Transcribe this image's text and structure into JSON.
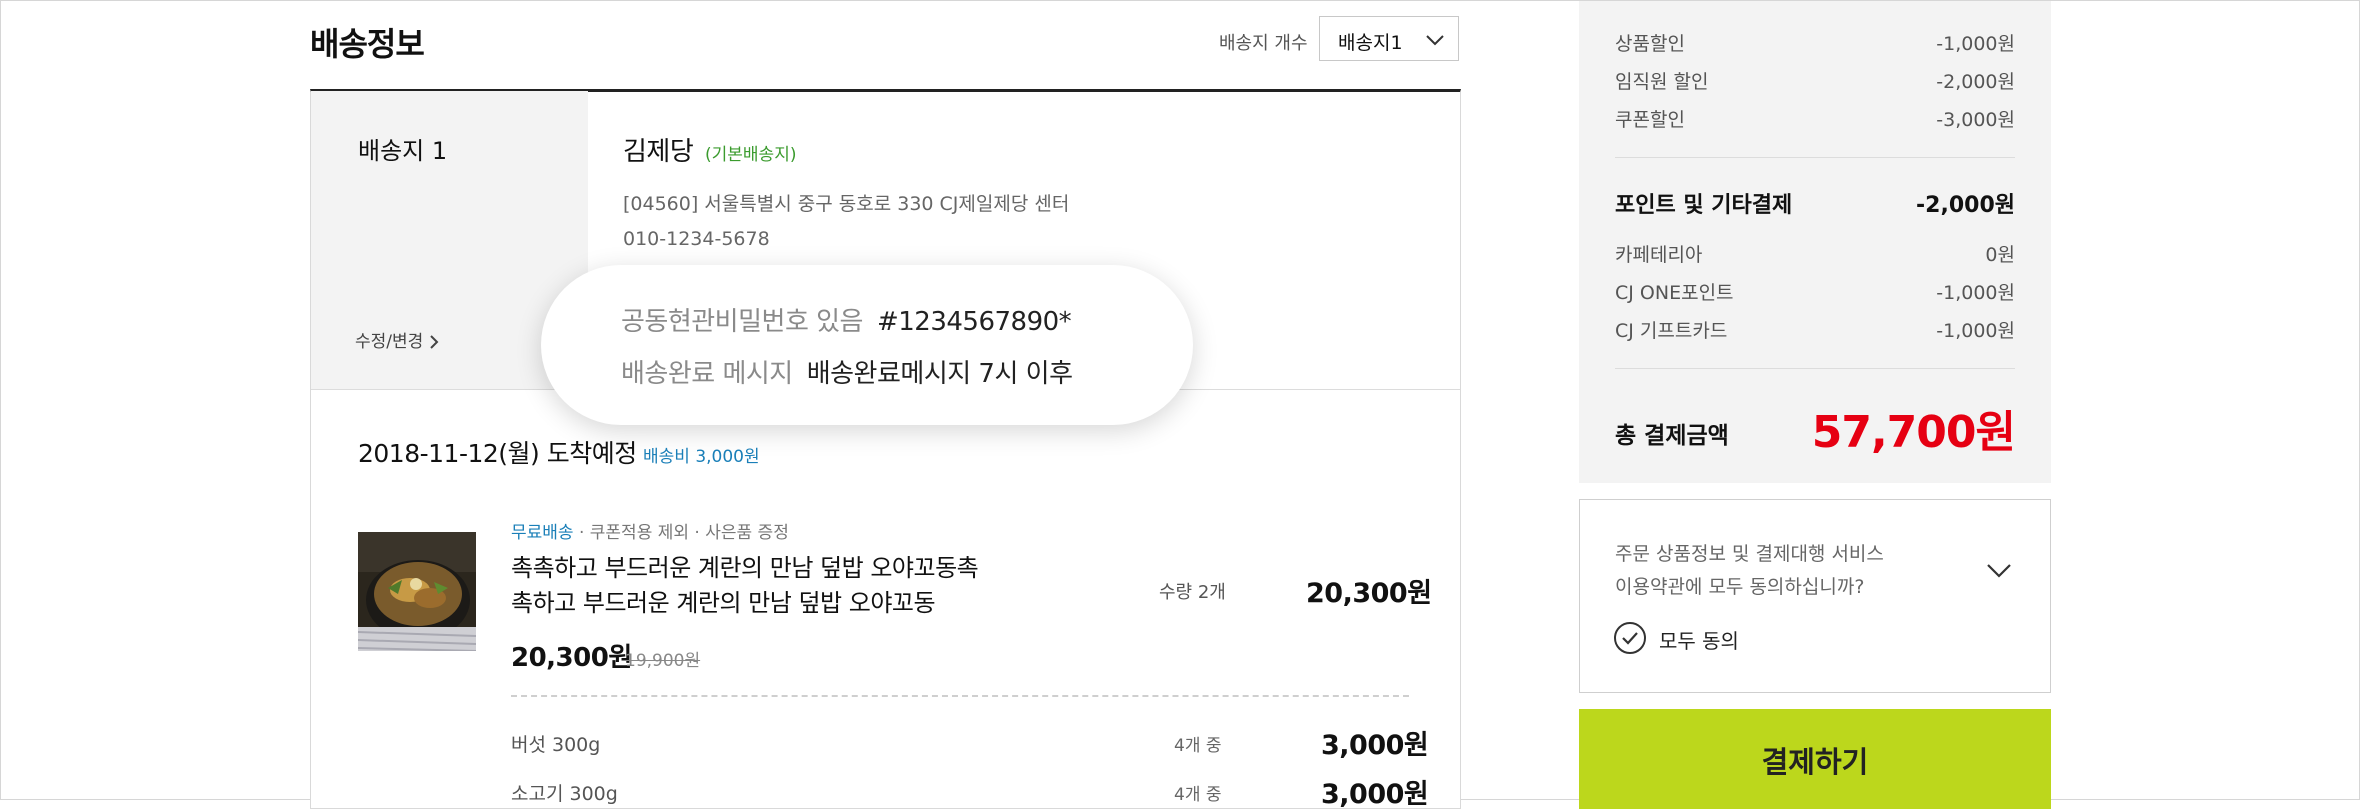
{
  "delivery": {
    "title": "배송정보",
    "count_label": "배송지 개수",
    "count_value": "배송지1",
    "address_label": "배송지 1",
    "edit_link": "수정/변경",
    "recipient": "김제당",
    "default_tag": "(기본배송지)",
    "address": "[04560] 서울특별시 중구 동호로 330 CJ제일제당 센터",
    "phone": "010-1234-5678",
    "callout": {
      "entrance_key": "공동현관비밀번호 있음",
      "entrance_value": "#1234567890*",
      "message_key": "배송완료 메시지",
      "message_value": "배송완료메시지 7시 이후"
    }
  },
  "shipment": {
    "arrival": "2018-11-12(월) 도착예정",
    "fee": "배송비 3,000원",
    "product": {
      "tag_free": "무료배송",
      "tag_rest": " · 쿠폰적용 제외 · 사은품 증정",
      "name_line1": "촉촉하고 부드러운 계란의 만남 덮밥 오야꼬동촉",
      "name_line2": "촉하고 부드러운 계란의 만남 덮밥 오야꼬동",
      "sale_price": "20,300원",
      "original_price": "19,900원",
      "qty": "수량 2개",
      "line_total": "20,300원"
    },
    "options": [
      {
        "name": "버섯 300g",
        "qty": "4개 중",
        "price": "3,000원"
      },
      {
        "name": "소고기 300g",
        "qty": "4개 중",
        "price": "3,000원"
      }
    ]
  },
  "summary": {
    "discounts": [
      {
        "label": "상품할인",
        "amount": "-1,000원"
      },
      {
        "label": "임직원 할인",
        "amount": "-2,000원"
      },
      {
        "label": "쿠폰할인",
        "amount": "-3,000원"
      }
    ],
    "points_header": {
      "label": "포인트 및 기타결제",
      "amount": "-2,000원"
    },
    "points": [
      {
        "label": "카페테리아",
        "amount": "0원"
      },
      {
        "label": "CJ ONE포인트",
        "amount": "-1,000원"
      },
      {
        "label": "CJ 기프트카드",
        "amount": "-1,000원"
      }
    ],
    "total_label": "총 결제금액",
    "total_amount": "57,700원",
    "total_color": "#e60012"
  },
  "agreement": {
    "text_line1": "주문 상품정보 및 결제대행 서비스",
    "text_line2": "이용약관에 모두 동의하십니까?",
    "agree_all": "모두 동의"
  },
  "pay_button": {
    "label": "결제하기",
    "color": "#bcd71c"
  }
}
